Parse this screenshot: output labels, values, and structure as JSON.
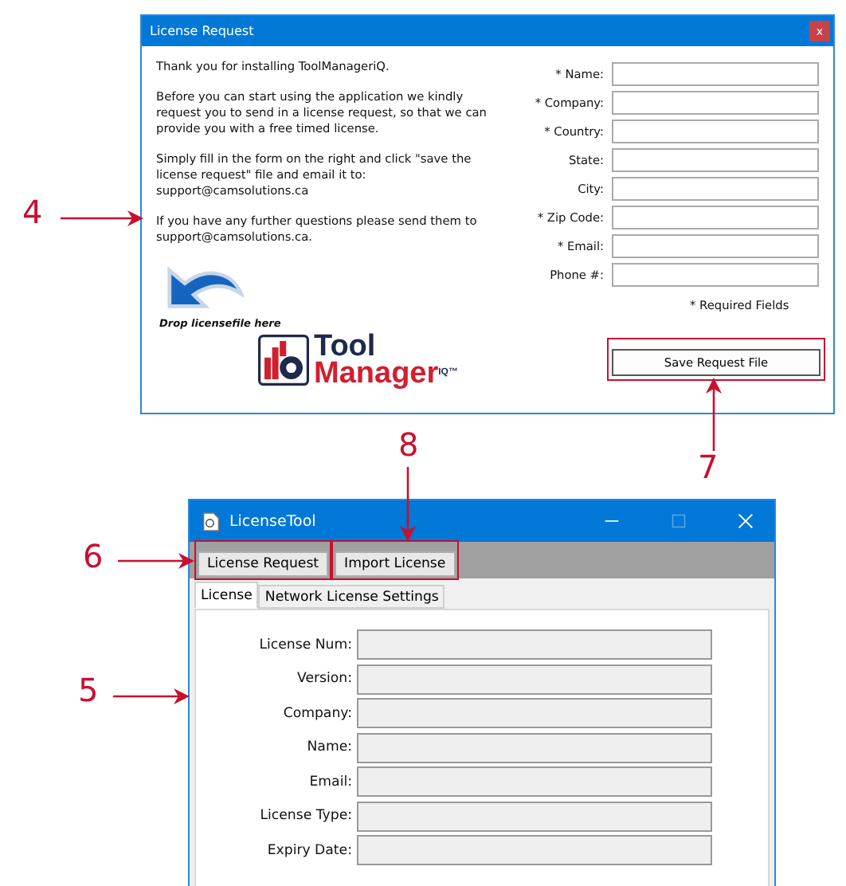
{
  "request_window": {
    "title": "License Request",
    "close": "x",
    "paragraphs": [
      "Thank you for installing ToolManageriQ.",
      "Before you can start using the application we kindly request you to send in a license request, so that we can provide you with a free timed license.",
      "Simply fill in the form on the right and click \"save the license request\" file and email it to: support@camsolutions.ca",
      "If you have any further questions please send them to support@camsolutions.ca."
    ],
    "drop_label": "Drop licensefile here",
    "logo": {
      "line_1": "Tool",
      "line_2": "Manager",
      "suffix": "IQ",
      "mark": "™"
    },
    "fields": [
      {
        "label": "* Name:"
      },
      {
        "label": "* Company:"
      },
      {
        "label": "* Country:"
      },
      {
        "label": "State:"
      },
      {
        "label": "City:"
      },
      {
        "label": "* Zip Code:"
      },
      {
        "label": "* Email:"
      },
      {
        "label": "Phone #:"
      }
    ],
    "note": "* Required Fields",
    "save_button": {
      "label": "Save Request File",
      "highlighted": true
    }
  },
  "tool_window": {
    "title": "LicenseTool",
    "toolbar": [
      {
        "label": "License Request",
        "highlighted": true
      },
      {
        "label": "Import License",
        "highlighted": true
      }
    ],
    "tabs": [
      {
        "label": "License",
        "selected": true
      },
      {
        "label": "Network License Settings",
        "selected": false
      }
    ],
    "fields": [
      {
        "label": "License Num:"
      },
      {
        "label": "Version:"
      },
      {
        "label": "Company:"
      },
      {
        "label": "Name:"
      },
      {
        "label": "Email:"
      },
      {
        "label": "License Type:"
      },
      {
        "label": "Expiry Date:"
      }
    ]
  },
  "callouts": [
    {
      "number": "4",
      "kind": "right"
    },
    {
      "number": "7",
      "kind": "up"
    },
    {
      "number": "8",
      "kind": "down"
    },
    {
      "number": "6",
      "kind": "right"
    },
    {
      "number": "5",
      "kind": "right"
    }
  ]
}
